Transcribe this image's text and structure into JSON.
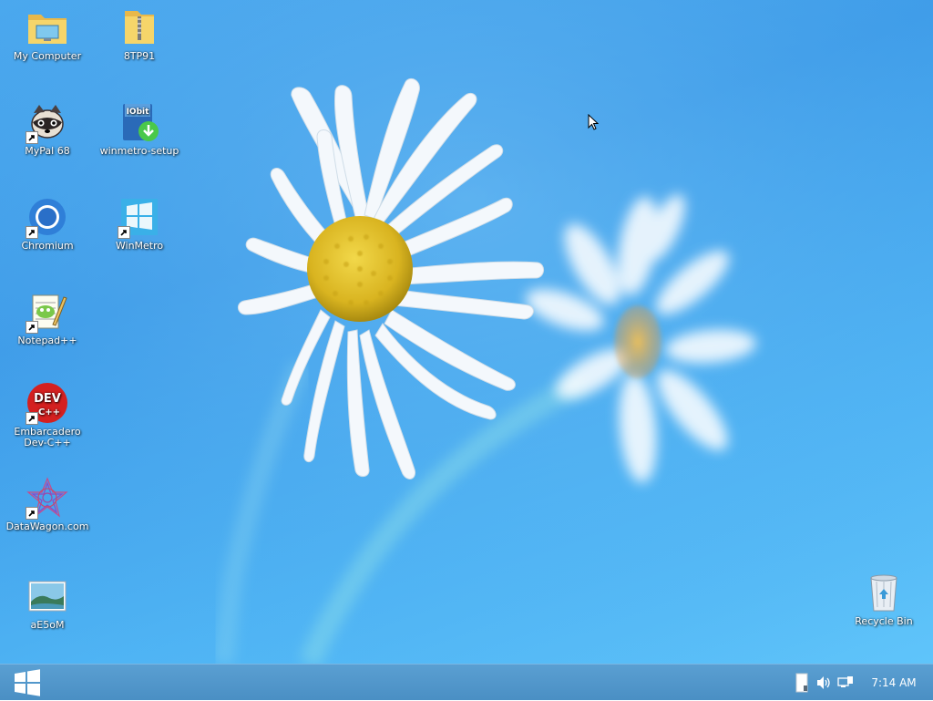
{
  "desktop": {
    "icons": [
      {
        "label": "My Computer",
        "icon": "folder-computer-icon",
        "shortcut": false
      },
      {
        "label": "8TP91",
        "icon": "zip-folder-icon",
        "shortcut": false
      },
      {
        "label": "MyPal 68",
        "icon": "raccoon-icon",
        "shortcut": true
      },
      {
        "label": "winmetro-setup",
        "icon": "iobit-installer-icon",
        "shortcut": false
      },
      {
        "label": "Chromium",
        "icon": "chromium-icon",
        "shortcut": true
      },
      {
        "label": "WinMetro",
        "icon": "windows-logo-icon",
        "shortcut": true
      },
      {
        "label": "Notepad++",
        "icon": "notepad-plus-plus-icon",
        "shortcut": true
      },
      {
        "label": "Embarcadero Dev-C++",
        "icon": "dev-cpp-icon",
        "shortcut": true
      },
      {
        "label": "DataWagon.com",
        "icon": "datawagon-icon",
        "shortcut": true
      },
      {
        "label": "aE5oM",
        "icon": "image-file-icon",
        "shortcut": false
      },
      {
        "label": "Recycle Bin",
        "icon": "recycle-bin-icon",
        "shortcut": false
      }
    ],
    "dev_logo_text": "DEV",
    "dev_logo_sub": "C++",
    "iobit_text": "IObit"
  },
  "taskbar": {
    "start_icon": "windows-start-icon",
    "tray_icons": [
      "show-desktop-icon",
      "volume-icon",
      "network-icon"
    ],
    "clock": "7:14 AM"
  },
  "colors": {
    "wallpaper_top": "#3d9be8",
    "wallpaper_bottom": "#5fc4fa",
    "taskbar": "#4a8fc4",
    "label_text": "#ffffff"
  }
}
